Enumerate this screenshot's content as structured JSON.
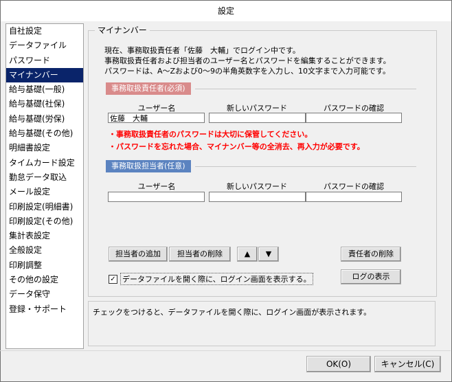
{
  "window": {
    "title": "設定"
  },
  "sidebar": {
    "items": [
      {
        "label": "自社設定"
      },
      {
        "label": "データファイル"
      },
      {
        "label": "パスワード"
      },
      {
        "label": "マイナンバー",
        "active": true
      },
      {
        "label": "給与基礎(一般)"
      },
      {
        "label": "給与基礎(社保)"
      },
      {
        "label": "給与基礎(労保)"
      },
      {
        "label": "給与基礎(その他)"
      },
      {
        "label": "明細書設定"
      },
      {
        "label": "タイムカード設定"
      },
      {
        "label": "勤怠データ取込"
      },
      {
        "label": "メール設定"
      },
      {
        "label": "印刷設定(明細書)"
      },
      {
        "label": "印刷設定(その他)"
      },
      {
        "label": "集計表設定"
      },
      {
        "label": "全般設定"
      },
      {
        "label": "印刷調整"
      },
      {
        "label": "その他の設定"
      },
      {
        "label": "データ保守"
      },
      {
        "label": "登録・サポート"
      }
    ]
  },
  "main": {
    "group_title": "マイナンバー",
    "intro": [
      "現在、事務取扱責任者「佐藤　大輔」でログイン中です。",
      "事務取扱責任者および担当者のユーザー名とパスワードを編集することができます。",
      "パスワードは、A～Zおよび0～9の半角英数字を入力し、10文字まで入力可能です。"
    ],
    "responsible": {
      "label": "事務取扱責任者(必須)",
      "label_color": "#d98b8b",
      "col_username": "ユーザー名",
      "col_new_password": "新しいパスワード",
      "col_confirm": "パスワードの確認",
      "username_value": "佐藤　大輔",
      "new_password_value": "",
      "confirm_value": "",
      "warnings": [
        "・事務取扱責任者のパスワードは大切に保管してください。",
        "・パスワードを忘れた場合、マイナンバー等の全消去、再入力が必要です。"
      ]
    },
    "staff": {
      "label": "事務取扱担当者(任意)",
      "label_color": "#5b83c0",
      "col_username": "ユーザー名",
      "col_new_password": "新しいパスワード",
      "col_confirm": "パスワードの確認",
      "username_value": "",
      "new_password_value": "",
      "confirm_value": ""
    },
    "buttons": {
      "add_staff": "担当者の追加",
      "delete_staff": "担当者の削除",
      "move_up": "▲",
      "move_down": "▼",
      "delete_responsible": "責任者の削除",
      "show_log": "ログの表示"
    },
    "checkbox": {
      "label": "データファイルを開く際に、ログイン画面を表示する。",
      "checked": true,
      "mark": "✓"
    },
    "info_text": "チェックをつけると、データファイルを開く際に、ログイン画面が表示されます。"
  },
  "footer": {
    "ok": "OK(O)",
    "cancel": "キャンセル(C)"
  }
}
